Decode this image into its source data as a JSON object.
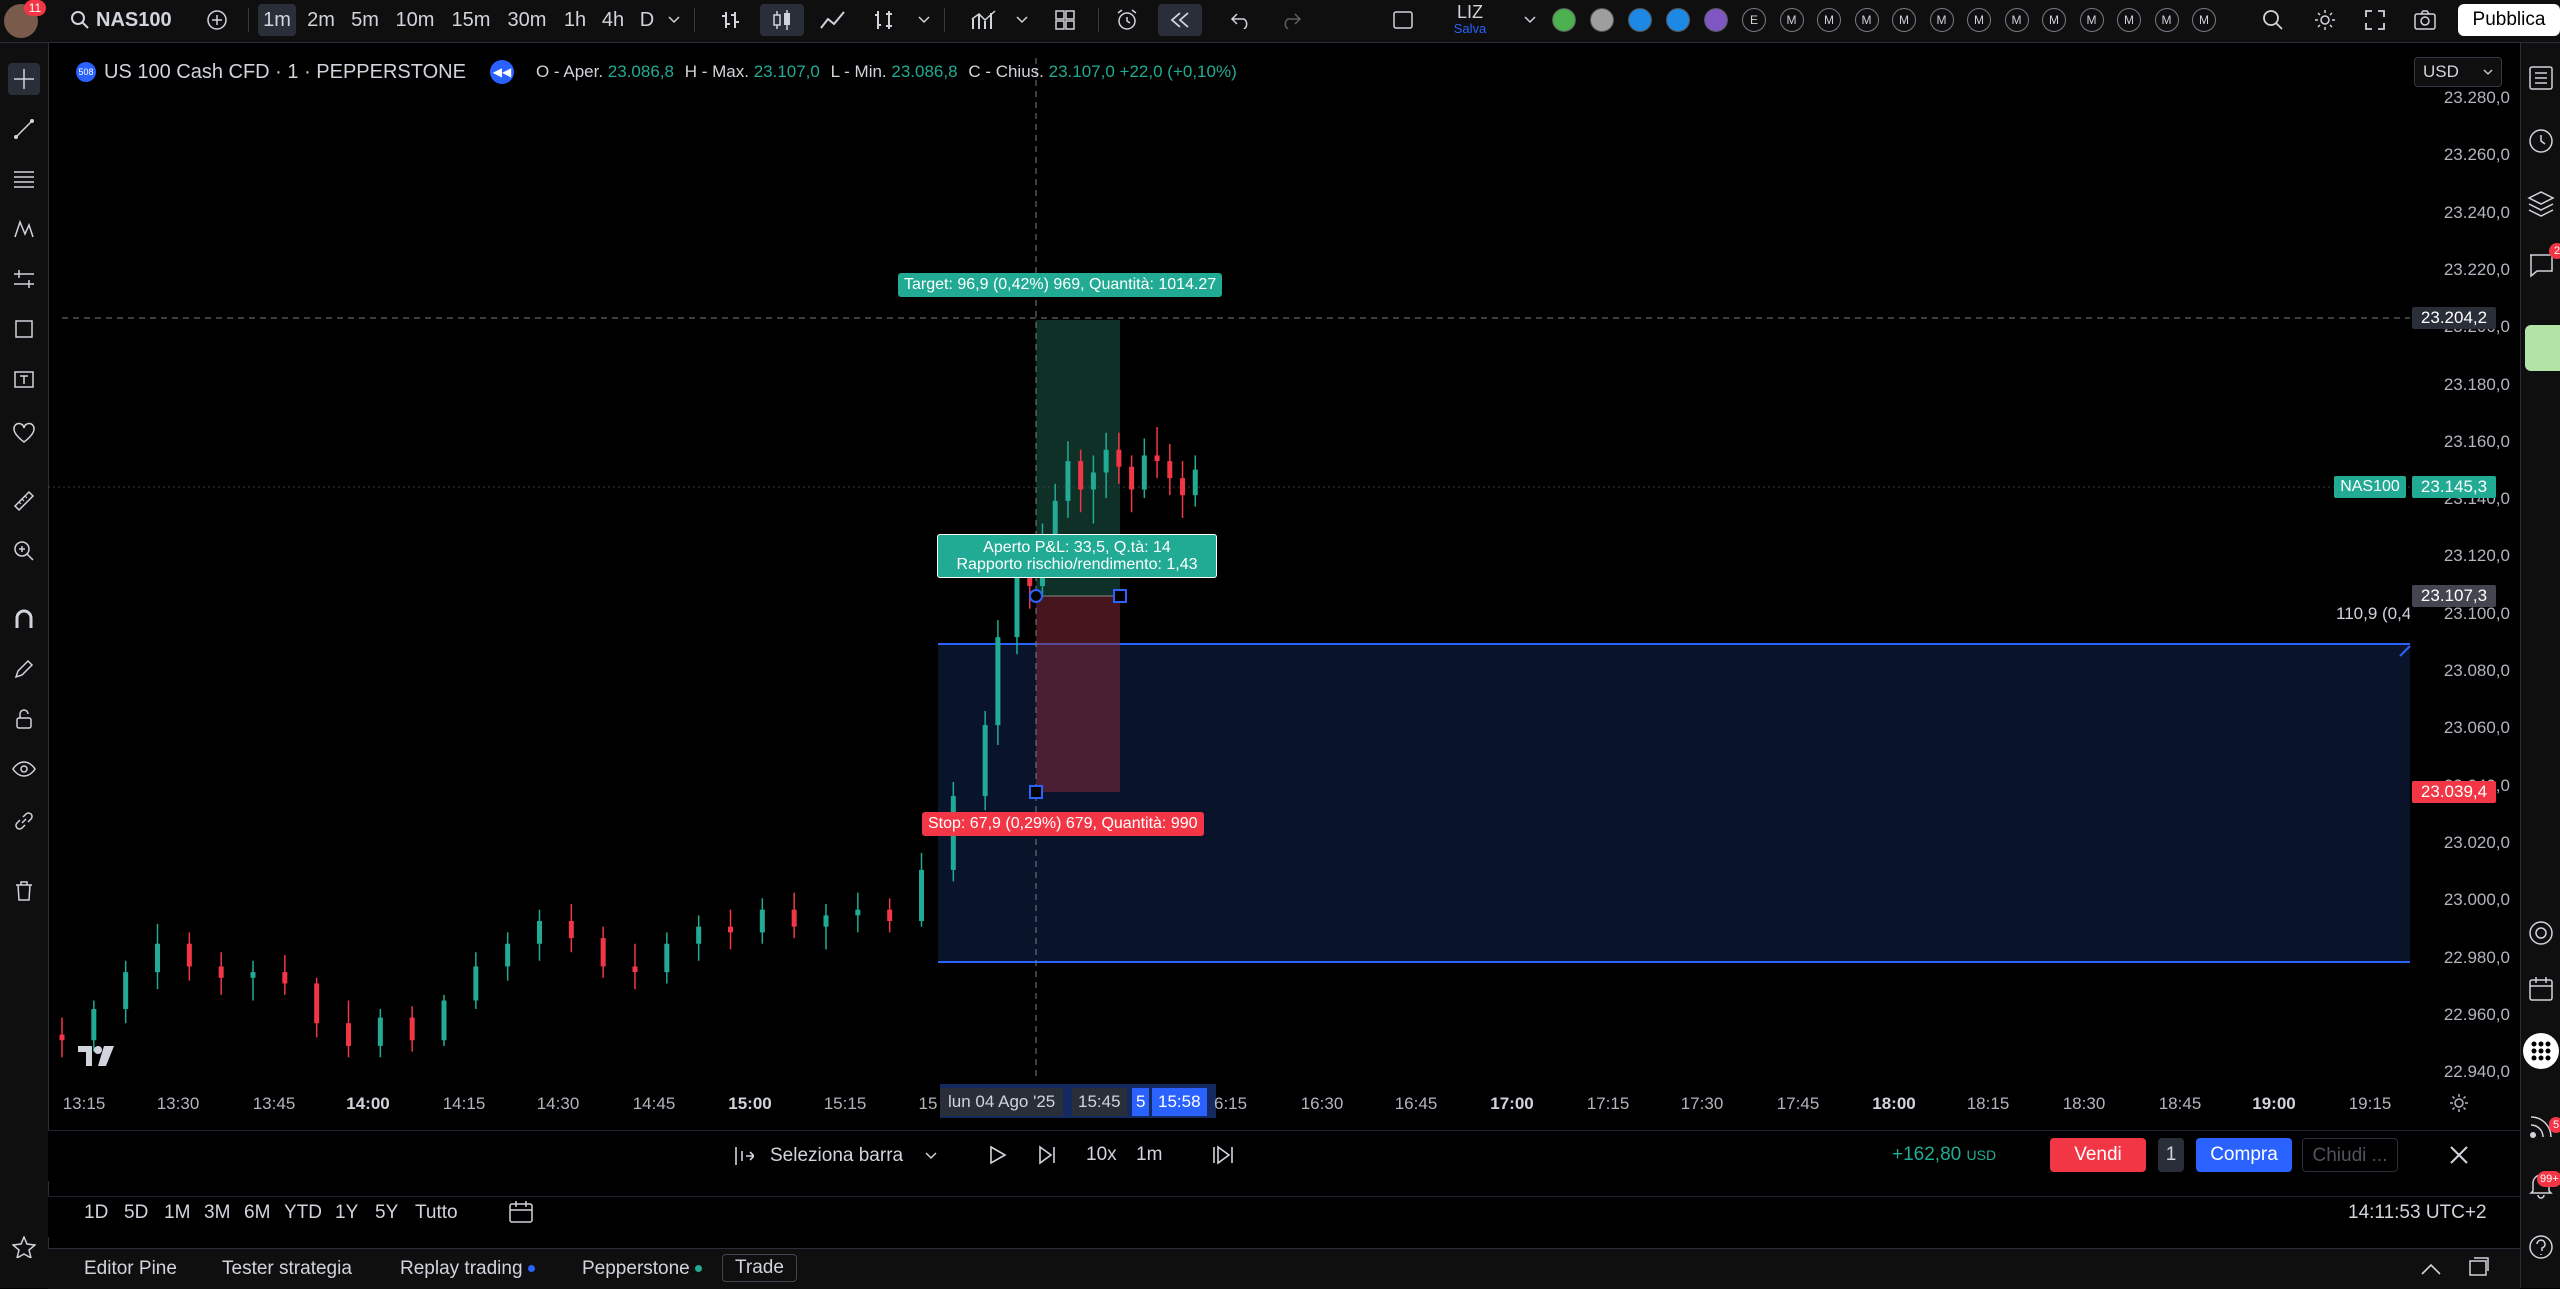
{
  "topbar": {
    "notif_count": "11",
    "symbol": "NAS100",
    "intervals": [
      "1m",
      "2m",
      "5m",
      "10m",
      "15m",
      "30m",
      "1h",
      "4h",
      "D"
    ],
    "selected_interval": "1m",
    "layout_name": "LIZ",
    "layout_status": "Salva",
    "alert_letters": [
      "E",
      "M",
      "M",
      "M",
      "M",
      "M",
      "M",
      "M",
      "M",
      "M",
      "M",
      "M",
      "M"
    ],
    "publish_label": "Pubblica"
  },
  "legend": {
    "title": "US 100 Cash CFD · 1 · PEPPERSTONE",
    "o_label": "O - Aper.",
    "o_value": "23.086,8",
    "h_label": "H - Max.",
    "h_value": "23.107,0",
    "l_label": "L - Min.",
    "l_value": "23.086,8",
    "c_label": "C - Chius.",
    "c_value": "23.107,0",
    "change": "+22,0 (+0,10%)",
    "currency": "USD"
  },
  "price_axis": {
    "ticks": [
      "23.280,0",
      "23.260,0",
      "23.240,0",
      "23.220,0",
      "23.200,0",
      "23.180,0",
      "23.160,0",
      "23.140,0",
      "23.120,0",
      "23.100,0",
      "23.080,0",
      "23.060,0",
      "23.040,0",
      "23.020,0",
      "23.000,0",
      "22.980,0",
      "22.960,0",
      "22.940,0"
    ],
    "crosshair_price": "23.204,2",
    "last_price": "23.145,3",
    "last_symbol": "NAS100",
    "entry_price": "23.107,3",
    "stop_price": "23.039,4",
    "range_label": "110,9 (0,4"
  },
  "position_tool": {
    "target": "Target: 96,9 (0,42%) 969, Quantità: 1014.27",
    "pnl_line1": "Aperto P&L: 33,5, Q.tà: 14",
    "pnl_line2": "Rapporto rischio/rendimento: 1,43",
    "stop": "Stop: 67,9 (0,29%) 679, Quantità: 990"
  },
  "time_axis": {
    "ticks": [
      "13:15",
      "13:30",
      "13:45",
      "14:00",
      "14:15",
      "14:30",
      "14:45",
      "15:00",
      "15:15",
      "15",
      "16:30",
      "16:45",
      "17:00",
      "17:15",
      "17:30",
      "17:45",
      "18:00",
      "18:15",
      "18:30",
      "18:45",
      "19:00",
      "19:15"
    ],
    "crosshair_date": "lun 04 Ago '25",
    "range_start": "15:45",
    "range_mid": "5",
    "range_end": "15:58",
    "after_range": "6:15"
  },
  "replay": {
    "select_bar": "Seleziona barra",
    "speed": "10x",
    "interval": "1m",
    "pnl": "+162,80",
    "pnl_currency": "USD",
    "sell": "Vendi",
    "qty": "1",
    "buy": "Compra",
    "close": "Chiudi ..."
  },
  "ranges": {
    "items": [
      "1D",
      "5D",
      "1M",
      "3M",
      "6M",
      "YTD",
      "1Y",
      "5Y",
      "Tutto"
    ],
    "clock": "14:11:53 UTC+2"
  },
  "tabs": {
    "items": [
      "Editor Pine",
      "Tester strategia",
      "Replay trading",
      "Pepperstone",
      "Trade"
    ]
  },
  "right": {
    "badge": "2",
    "badge2": "5",
    "badge3": "99+"
  },
  "colors": {
    "green": "#22ab94",
    "red": "#f23645",
    "blue": "#2962ff",
    "bg": "#000000"
  },
  "chart_data": {
    "type": "candlestick",
    "x_unit": "time",
    "ylim": [
      22930,
      23290
    ],
    "candles": [
      [
        "13:15",
        22946,
        22952,
        22938,
        22944
      ],
      [
        "13:20",
        22944,
        22958,
        22940,
        22955
      ],
      [
        "13:25",
        22955,
        22972,
        22950,
        22968
      ],
      [
        "13:30",
        22968,
        22985,
        22962,
        22978
      ],
      [
        "13:35",
        22978,
        22982,
        22965,
        22970
      ],
      [
        "13:40",
        22970,
        22975,
        22960,
        22966
      ],
      [
        "13:45",
        22966,
        22972,
        22958,
        22968
      ],
      [
        "13:50",
        22968,
        22974,
        22960,
        22964
      ],
      [
        "13:55",
        22964,
        22966,
        22945,
        22950
      ],
      [
        "14:00",
        22950,
        22958,
        22938,
        22942
      ],
      [
        "14:05",
        22942,
        22955,
        22938,
        22952
      ],
      [
        "14:10",
        22952,
        22956,
        22940,
        22944
      ],
      [
        "14:15",
        22944,
        22960,
        22942,
        22958
      ],
      [
        "14:20",
        22958,
        22975,
        22955,
        22970
      ],
      [
        "14:25",
        22970,
        22982,
        22965,
        22978
      ],
      [
        "14:30",
        22978,
        22990,
        22972,
        22986
      ],
      [
        "14:35",
        22986,
        22992,
        22975,
        22980
      ],
      [
        "14:40",
        22980,
        22984,
        22966,
        22970
      ],
      [
        "14:45",
        22970,
        22978,
        22962,
        22968
      ],
      [
        "14:50",
        22968,
        22982,
        22964,
        22978
      ],
      [
        "14:55",
        22978,
        22988,
        22972,
        22984
      ],
      [
        "15:00",
        22984,
        22990,
        22976,
        22982
      ],
      [
        "15:05",
        22982,
        22994,
        22978,
        22990
      ],
      [
        "15:10",
        22990,
        22996,
        22980,
        22984
      ],
      [
        "15:15",
        22984,
        22992,
        22976,
        22988
      ],
      [
        "15:20",
        22988,
        22996,
        22982,
        22990
      ],
      [
        "15:25",
        22990,
        22994,
        22982,
        22986
      ],
      [
        "15:30",
        22986,
        23010,
        22984,
        23004
      ],
      [
        "15:35",
        23004,
        23035,
        23000,
        23030
      ],
      [
        "15:40",
        23030,
        23060,
        23025,
        23055
      ],
      [
        "15:42",
        23055,
        23092,
        23048,
        23086
      ],
      [
        "15:45",
        23086,
        23120,
        23080,
        23112
      ],
      [
        "15:47",
        23112,
        23122,
        23096,
        23104
      ],
      [
        "15:49",
        23104,
        23126,
        23100,
        23118
      ],
      [
        "15:51",
        23118,
        23140,
        23112,
        23134
      ],
      [
        "15:53",
        23134,
        23155,
        23128,
        23148
      ],
      [
        "15:55",
        23148,
        23152,
        23130,
        23138
      ],
      [
        "15:57",
        23138,
        23150,
        23126,
        23144
      ],
      [
        "15:59",
        23144,
        23158,
        23135,
        23152
      ],
      [
        "16:01",
        23152,
        23158,
        23140,
        23146
      ],
      [
        "16:03",
        23146,
        23150,
        23130,
        23138
      ],
      [
        "16:05",
        23138,
        23156,
        23135,
        23150
      ],
      [
        "16:07",
        23150,
        23160,
        23142,
        23148
      ],
      [
        "16:09",
        23148,
        23154,
        23136,
        23142
      ],
      [
        "16:11",
        23142,
        23148,
        23128,
        23136
      ],
      [
        "16:13",
        23136,
        23150,
        23132,
        23145
      ]
    ]
  }
}
